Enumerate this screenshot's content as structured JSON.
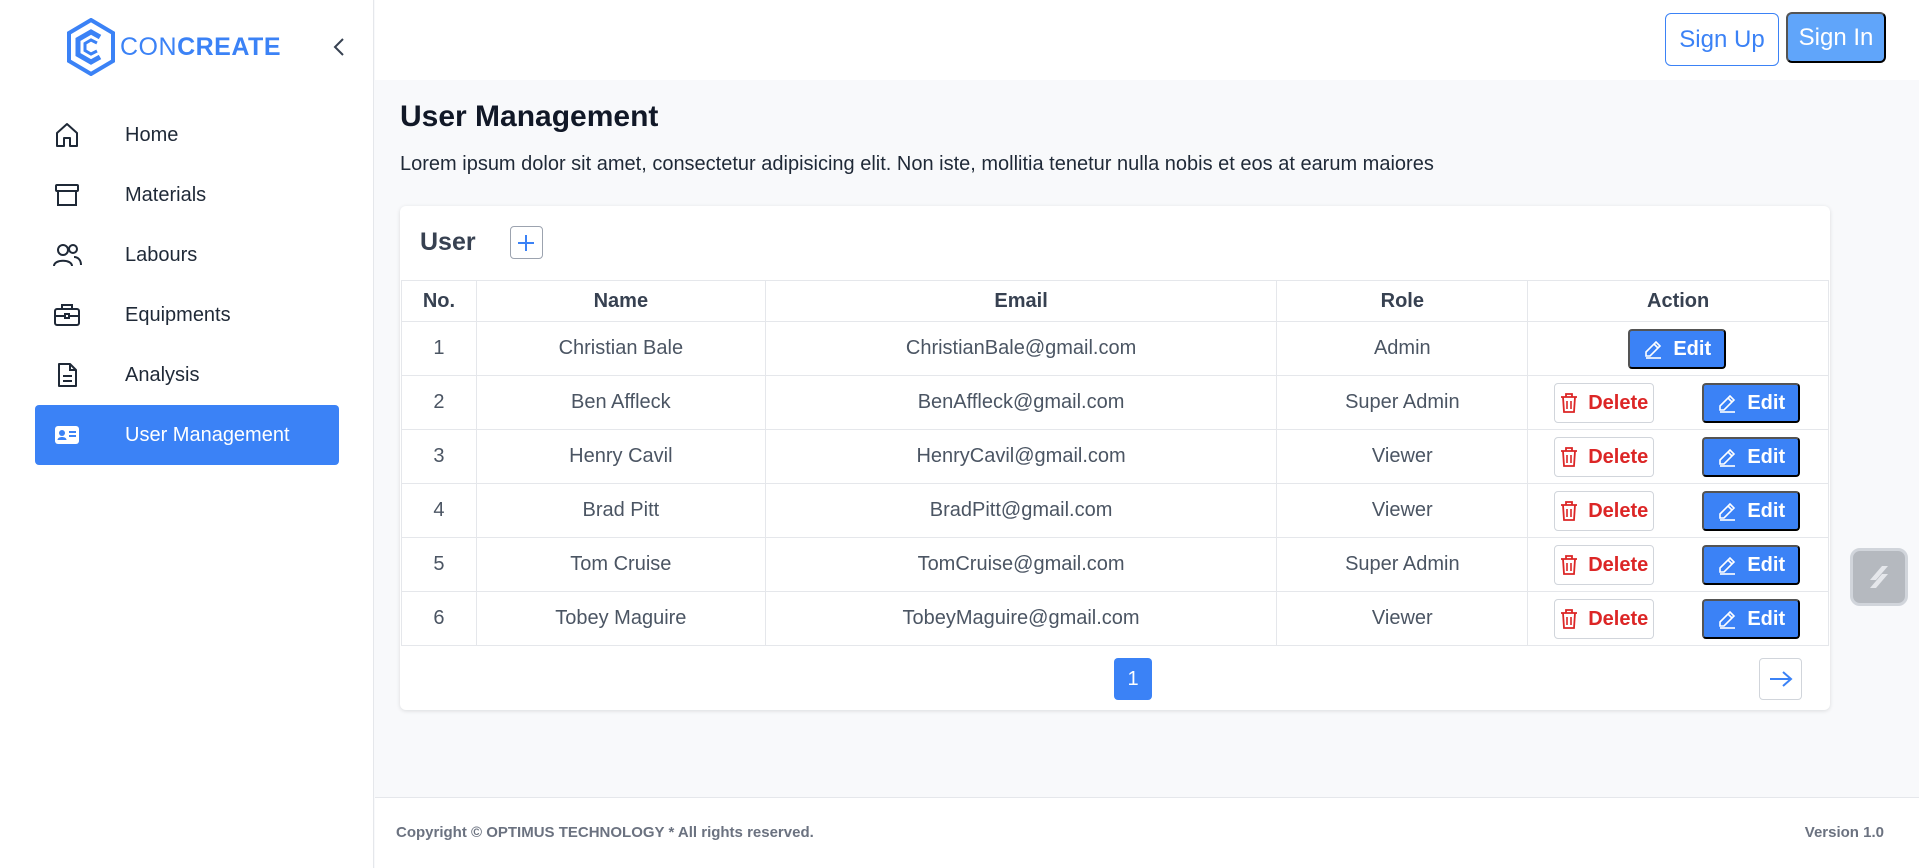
{
  "brand": {
    "name_light": "CON",
    "name_bold": "CREATE"
  },
  "sidebar": {
    "items": [
      {
        "label": "Home",
        "icon": "home-icon"
      },
      {
        "label": "Materials",
        "icon": "archive-icon"
      },
      {
        "label": "Labours",
        "icon": "users-icon"
      },
      {
        "label": "Equipments",
        "icon": "briefcase-icon"
      },
      {
        "label": "Analysis",
        "icon": "document-icon"
      },
      {
        "label": "User Management",
        "icon": "id-card-icon",
        "active": true
      }
    ]
  },
  "header": {
    "signup_label": "Sign Up",
    "signin_label": "Sign In"
  },
  "main": {
    "title": "User Management",
    "description": "Lorem ipsum dolor sit amet, consectetur adipisicing elit. Non iste, mollitia tenetur nulla nobis et eos at earum maiores"
  },
  "card": {
    "title": "User",
    "columns": [
      "No.",
      "Name",
      "Email",
      "Role",
      "Action"
    ],
    "delete_label": "Delete",
    "edit_label": "Edit",
    "rows": [
      {
        "no": "1",
        "name": "Christian Bale",
        "email": "ChristianBale@gmail.com",
        "role": "Admin"
      },
      {
        "no": "2",
        "name": "Ben Affleck",
        "email": "BenAffleck@gmail.com",
        "role": "Super Admin"
      },
      {
        "no": "3",
        "name": "Henry Cavil",
        "email": "HenryCavil@gmail.com",
        "role": "Viewer"
      },
      {
        "no": "4",
        "name": "Brad Pitt",
        "email": "BradPitt@gmail.com",
        "role": "Viewer"
      },
      {
        "no": "5",
        "name": "Tom Cruise",
        "email": "TomCruise@gmail.com",
        "role": "Super Admin"
      },
      {
        "no": "6",
        "name": "Tobey Maguire",
        "email": "TobeyMaguire@gmail.com",
        "role": "Viewer"
      }
    ],
    "current_page": "1"
  },
  "footer": {
    "copyright": "Copyright © OPTIMUS TECHNOLOGY * All rights reserved.",
    "version": "Version 1.0"
  },
  "colors": {
    "accent": "#3b82f6",
    "danger": "#dc2626"
  }
}
